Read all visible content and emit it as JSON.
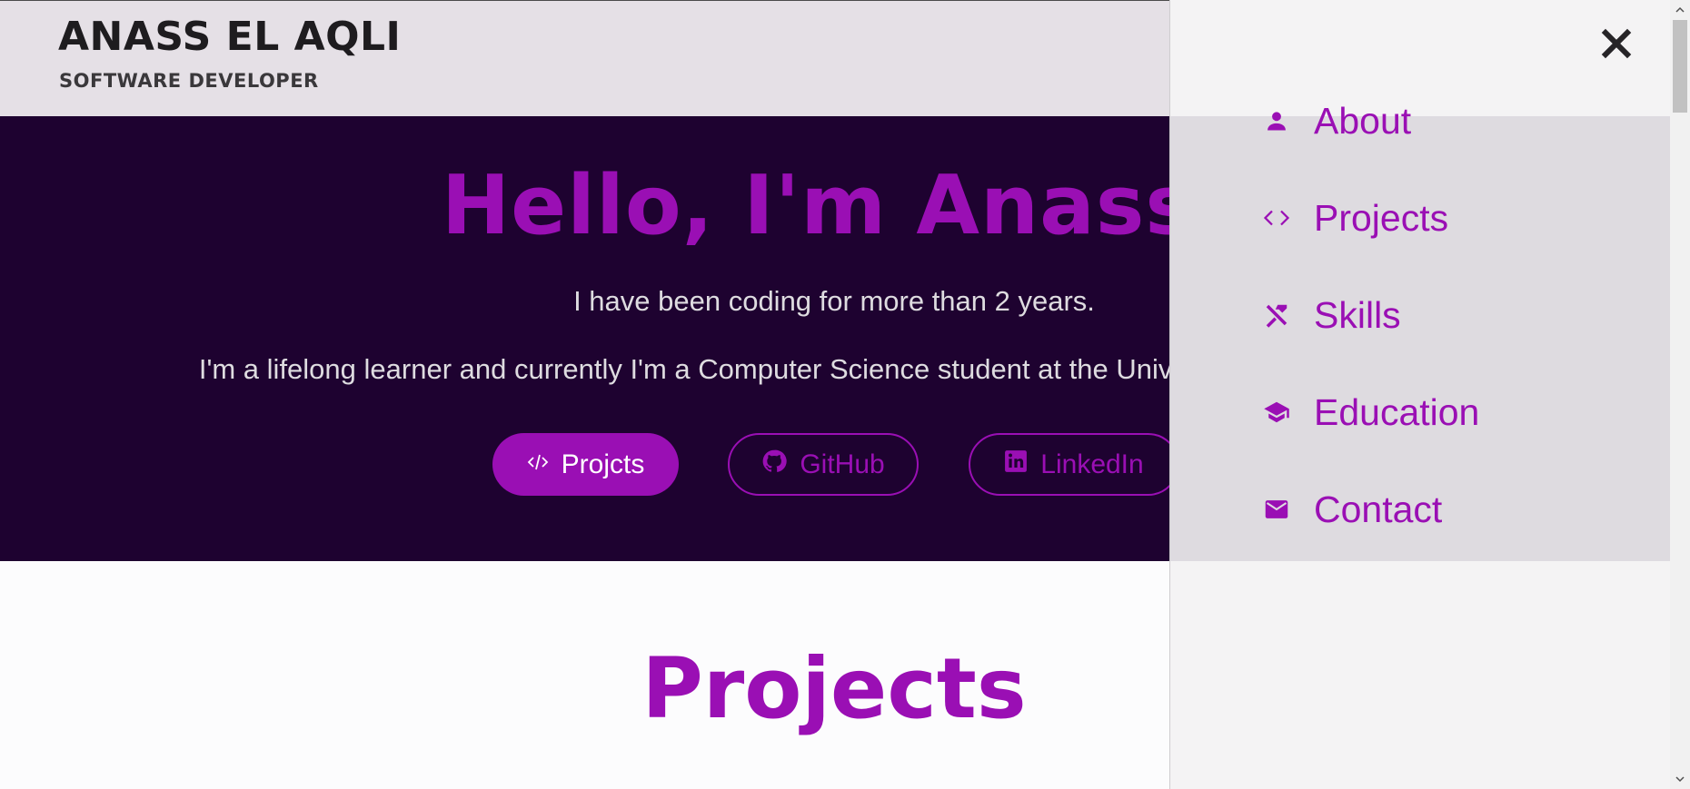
{
  "header": {
    "name": "ANASS EL AQLI",
    "role": "SOFTWARE DEVELOPER"
  },
  "hero": {
    "title": "Hello, I'm Anass.",
    "line1": "I have been coding for more than 2 years.",
    "line2": "I'm a lifelong learner and currently I'm a Computer Science student at the University of Pécs, Hungary.",
    "buttons": {
      "projects": {
        "label": "Projcts",
        "icon": "code-icon"
      },
      "github": {
        "label": "GitHub",
        "icon": "github-icon"
      },
      "linkedin": {
        "label": "LinkedIn",
        "icon": "linkedin-icon"
      }
    }
  },
  "sections": {
    "projects_title": "Projects"
  },
  "drawer": {
    "close_icon": "close-icon",
    "items": [
      {
        "label": "About",
        "icon": "person-icon"
      },
      {
        "label": "Projects",
        "icon": "code-icon"
      },
      {
        "label": "Skills",
        "icon": "tools-icon"
      },
      {
        "label": "Education",
        "icon": "graduation-cap-icon"
      },
      {
        "label": "Contact",
        "icon": "mail-icon"
      }
    ]
  },
  "colors": {
    "accent": "#9a0fb4",
    "hero_bg": "#1e0230",
    "header_bg": "#e5e0e6",
    "drawer_bg": "#f4f3f4"
  }
}
